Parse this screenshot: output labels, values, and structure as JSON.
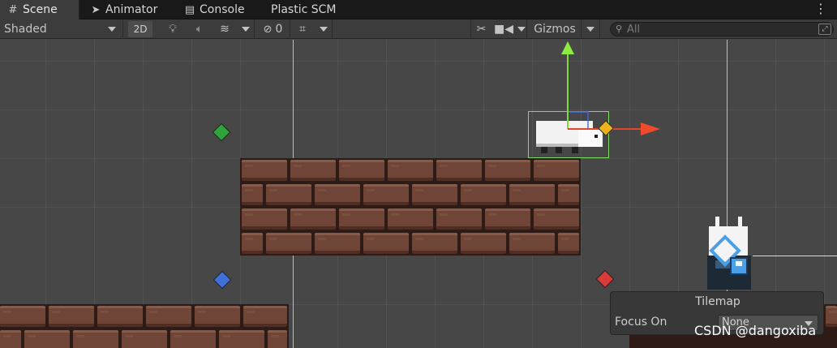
{
  "tabs": [
    {
      "label": "Scene",
      "icon": "grid-icon",
      "active": true
    },
    {
      "label": "Animator",
      "icon": "animator-icon",
      "active": false
    },
    {
      "label": "Console",
      "icon": "console-icon",
      "active": false
    },
    {
      "label": "Plastic SCM",
      "icon": "",
      "active": false
    }
  ],
  "toolbar": {
    "shading_mode": "Shaded",
    "mode_2d_label": "2D",
    "hidden_count": "0",
    "gizmos_label": "Gizmos",
    "search_placeholder": "All"
  },
  "overlay": {
    "title": "Tilemap",
    "focus_label": "Focus On",
    "focus_value": "None"
  },
  "watermark": "CSDN @dangoxiba",
  "colors": {
    "gem_green": "#2fa43a",
    "gem_blue": "#3f6fd8",
    "gem_red": "#d93a3a",
    "gem_orange": "#f0b21a",
    "gizmo_y": "#7bdc3c",
    "gizmo_x": "#f04a2c",
    "selection": "#7fdc62"
  }
}
